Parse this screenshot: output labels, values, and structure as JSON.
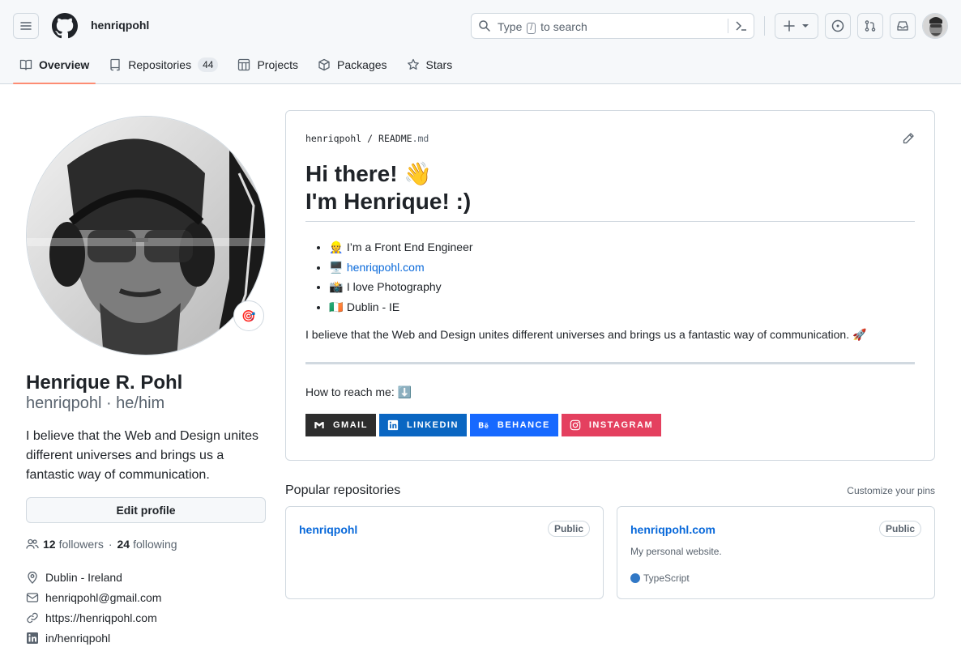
{
  "header": {
    "username": "henriqpohl",
    "search": {
      "before": "Type",
      "key": "/",
      "after": "to search"
    }
  },
  "tabs": [
    {
      "label": "Overview",
      "icon": "book-icon",
      "active": true
    },
    {
      "label": "Repositories",
      "icon": "repo-icon",
      "count": "44"
    },
    {
      "label": "Projects",
      "icon": "table-icon"
    },
    {
      "label": "Packages",
      "icon": "package-icon"
    },
    {
      "label": "Stars",
      "icon": "star-icon"
    }
  ],
  "profile": {
    "status_emoji": "🎯",
    "name": "Henrique R. Pohl",
    "login_line": "henriqpohl · he/him",
    "bio": "I believe that the Web and Design unites different universes and brings us a fantastic way of communication.",
    "edit_label": "Edit profile",
    "followers_count": "12",
    "followers_label": "followers",
    "following_count": "24",
    "following_label": "following",
    "location": "Dublin - Ireland",
    "email": "henriqpohl@gmail.com",
    "website": "https://henriqpohl.com",
    "linkedin": "in/henriqpohl"
  },
  "readme": {
    "owner": "henriqpohl",
    "file": "README",
    "ext": ".md",
    "heading_line1": "Hi there! 👋",
    "heading_line2": "I'm Henrique! :)",
    "bullets": [
      {
        "emoji": "👷",
        "text": "I’m a Front End Engineer"
      },
      {
        "emoji": "🖥️",
        "text": "henriqpohl.com",
        "link": true
      },
      {
        "emoji": "📸",
        "text": "I love Photography"
      },
      {
        "emoji": "🇮🇪",
        "text": "Dublin - IE"
      }
    ],
    "belief": "I believe that the Web and Design unites different universes and brings us a fantastic way of communication. 🚀",
    "reach": "How to reach me: ⬇️",
    "badges": [
      {
        "label": "GMAIL",
        "color": "#2d2d2d",
        "icon": "gmail-icon"
      },
      {
        "label": "LINKEDIN",
        "color": "#0a66c2",
        "icon": "linkedin-icon"
      },
      {
        "label": "BEHANCE",
        "color": "#1769ff",
        "icon": "behance-icon"
      },
      {
        "label": "INSTAGRAM",
        "color": "#e4405f",
        "icon": "instagram-icon"
      }
    ]
  },
  "popular": {
    "title": "Popular repositories",
    "customize": "Customize your pins",
    "repos": [
      {
        "name": "henriqpohl",
        "visibility": "Public",
        "description": "",
        "language": ""
      },
      {
        "name": "henriqpohl.com",
        "visibility": "Public",
        "description": "My personal website.",
        "language": "TypeScript",
        "language_color": "#3178c6"
      }
    ]
  },
  "colors": {
    "accent": "#fd8c73",
    "link": "#0969da",
    "muted": "#59636e"
  }
}
